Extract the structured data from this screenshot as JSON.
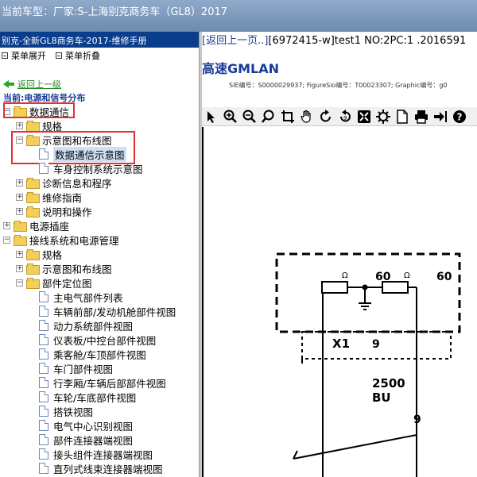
{
  "window": {
    "title_prefix": "当前车型：",
    "title": "厂家:S-上海别克商务车（GL8）2017"
  },
  "left_pane": {
    "header": "别克-全新GL8商务车-2017-维修手册",
    "toolbar": {
      "expand_all": "菜单展开",
      "collapse_all": "菜单折叠"
    },
    "back_link": "返回上一级",
    "current": "当前:电源和信号分布",
    "tree": [
      {
        "label": "数据通信",
        "type": "folder",
        "level": 0,
        "expanded": true,
        "highlight": true
      },
      {
        "label": "规格",
        "type": "folder",
        "level": 1,
        "expanded": false
      },
      {
        "label": "示意图和布线图",
        "type": "folder",
        "level": 1,
        "expanded": true,
        "highlight": true
      },
      {
        "label": "数据通信示意图",
        "type": "doc",
        "level": 2,
        "selected": true
      },
      {
        "label": "车身控制系统示意图",
        "type": "doc",
        "level": 2
      },
      {
        "label": "诊断信息和程序",
        "type": "folder",
        "level": 1,
        "expanded": false
      },
      {
        "label": "维修指南",
        "type": "folder",
        "level": 1,
        "expanded": false
      },
      {
        "label": "说明和操作",
        "type": "folder",
        "level": 1,
        "expanded": false
      },
      {
        "label": "电源插座",
        "type": "folder",
        "level": 0,
        "expanded": false
      },
      {
        "label": "接线系统和电源管理",
        "type": "folder",
        "level": 0,
        "expanded": true
      },
      {
        "label": "规格",
        "type": "folder",
        "level": 1,
        "expanded": false
      },
      {
        "label": "示意图和布线图",
        "type": "folder",
        "level": 1,
        "expanded": false
      },
      {
        "label": "部件定位图",
        "type": "folder",
        "level": 1,
        "expanded": true
      },
      {
        "label": "主电气部件列表",
        "type": "doc",
        "level": 2
      },
      {
        "label": "车辆前部/发动机舱部件视图",
        "type": "doc",
        "level": 2
      },
      {
        "label": "动力系统部件视图",
        "type": "doc",
        "level": 2
      },
      {
        "label": "仪表板/中控台部件视图",
        "type": "doc",
        "level": 2
      },
      {
        "label": "乘客舱/车顶部件视图",
        "type": "doc",
        "level": 2
      },
      {
        "label": "车门部件视图",
        "type": "doc",
        "level": 2
      },
      {
        "label": "行李厢/车辆后部部件视图",
        "type": "doc",
        "level": 2
      },
      {
        "label": "车轮/车底部件视图",
        "type": "doc",
        "level": 2
      },
      {
        "label": "搭铁视图",
        "type": "doc",
        "level": 2
      },
      {
        "label": "电气中心识别视图",
        "type": "doc",
        "level": 2
      },
      {
        "label": "部件连接器端视图",
        "type": "doc",
        "level": 2
      },
      {
        "label": "接头组件连接器端视图",
        "type": "doc",
        "level": 2
      },
      {
        "label": "直列式线束连接器端视图",
        "type": "doc",
        "level": 2
      }
    ]
  },
  "right_pane": {
    "back_label": "[返回上一页..]",
    "doc_ref": "[6972415-w]test1 NO:2PC:1 .2016591",
    "title": "高速GMLAN",
    "meta": "SIE编号：S0000029937;  FigureSio编号：T00023307;  Graphic编号：g0",
    "diagram": {
      "resistor_unit": "Ω",
      "value_60a": "60",
      "value_60b": "60",
      "connector": "X1",
      "pin": "9",
      "wire_gauge": "2500",
      "wire_color": "BU",
      "pin_lower": "9"
    }
  },
  "toolbar_icons": [
    "pointer-icon",
    "zoom-in-icon",
    "zoom-out-icon",
    "search-icon",
    "crop-icon",
    "pan-hand-icon",
    "rotate-right-icon",
    "rotate-left-icon",
    "fit-page-icon",
    "settings-icon",
    "page-icon",
    "print-icon",
    "export-icon",
    "help-icon"
  ]
}
